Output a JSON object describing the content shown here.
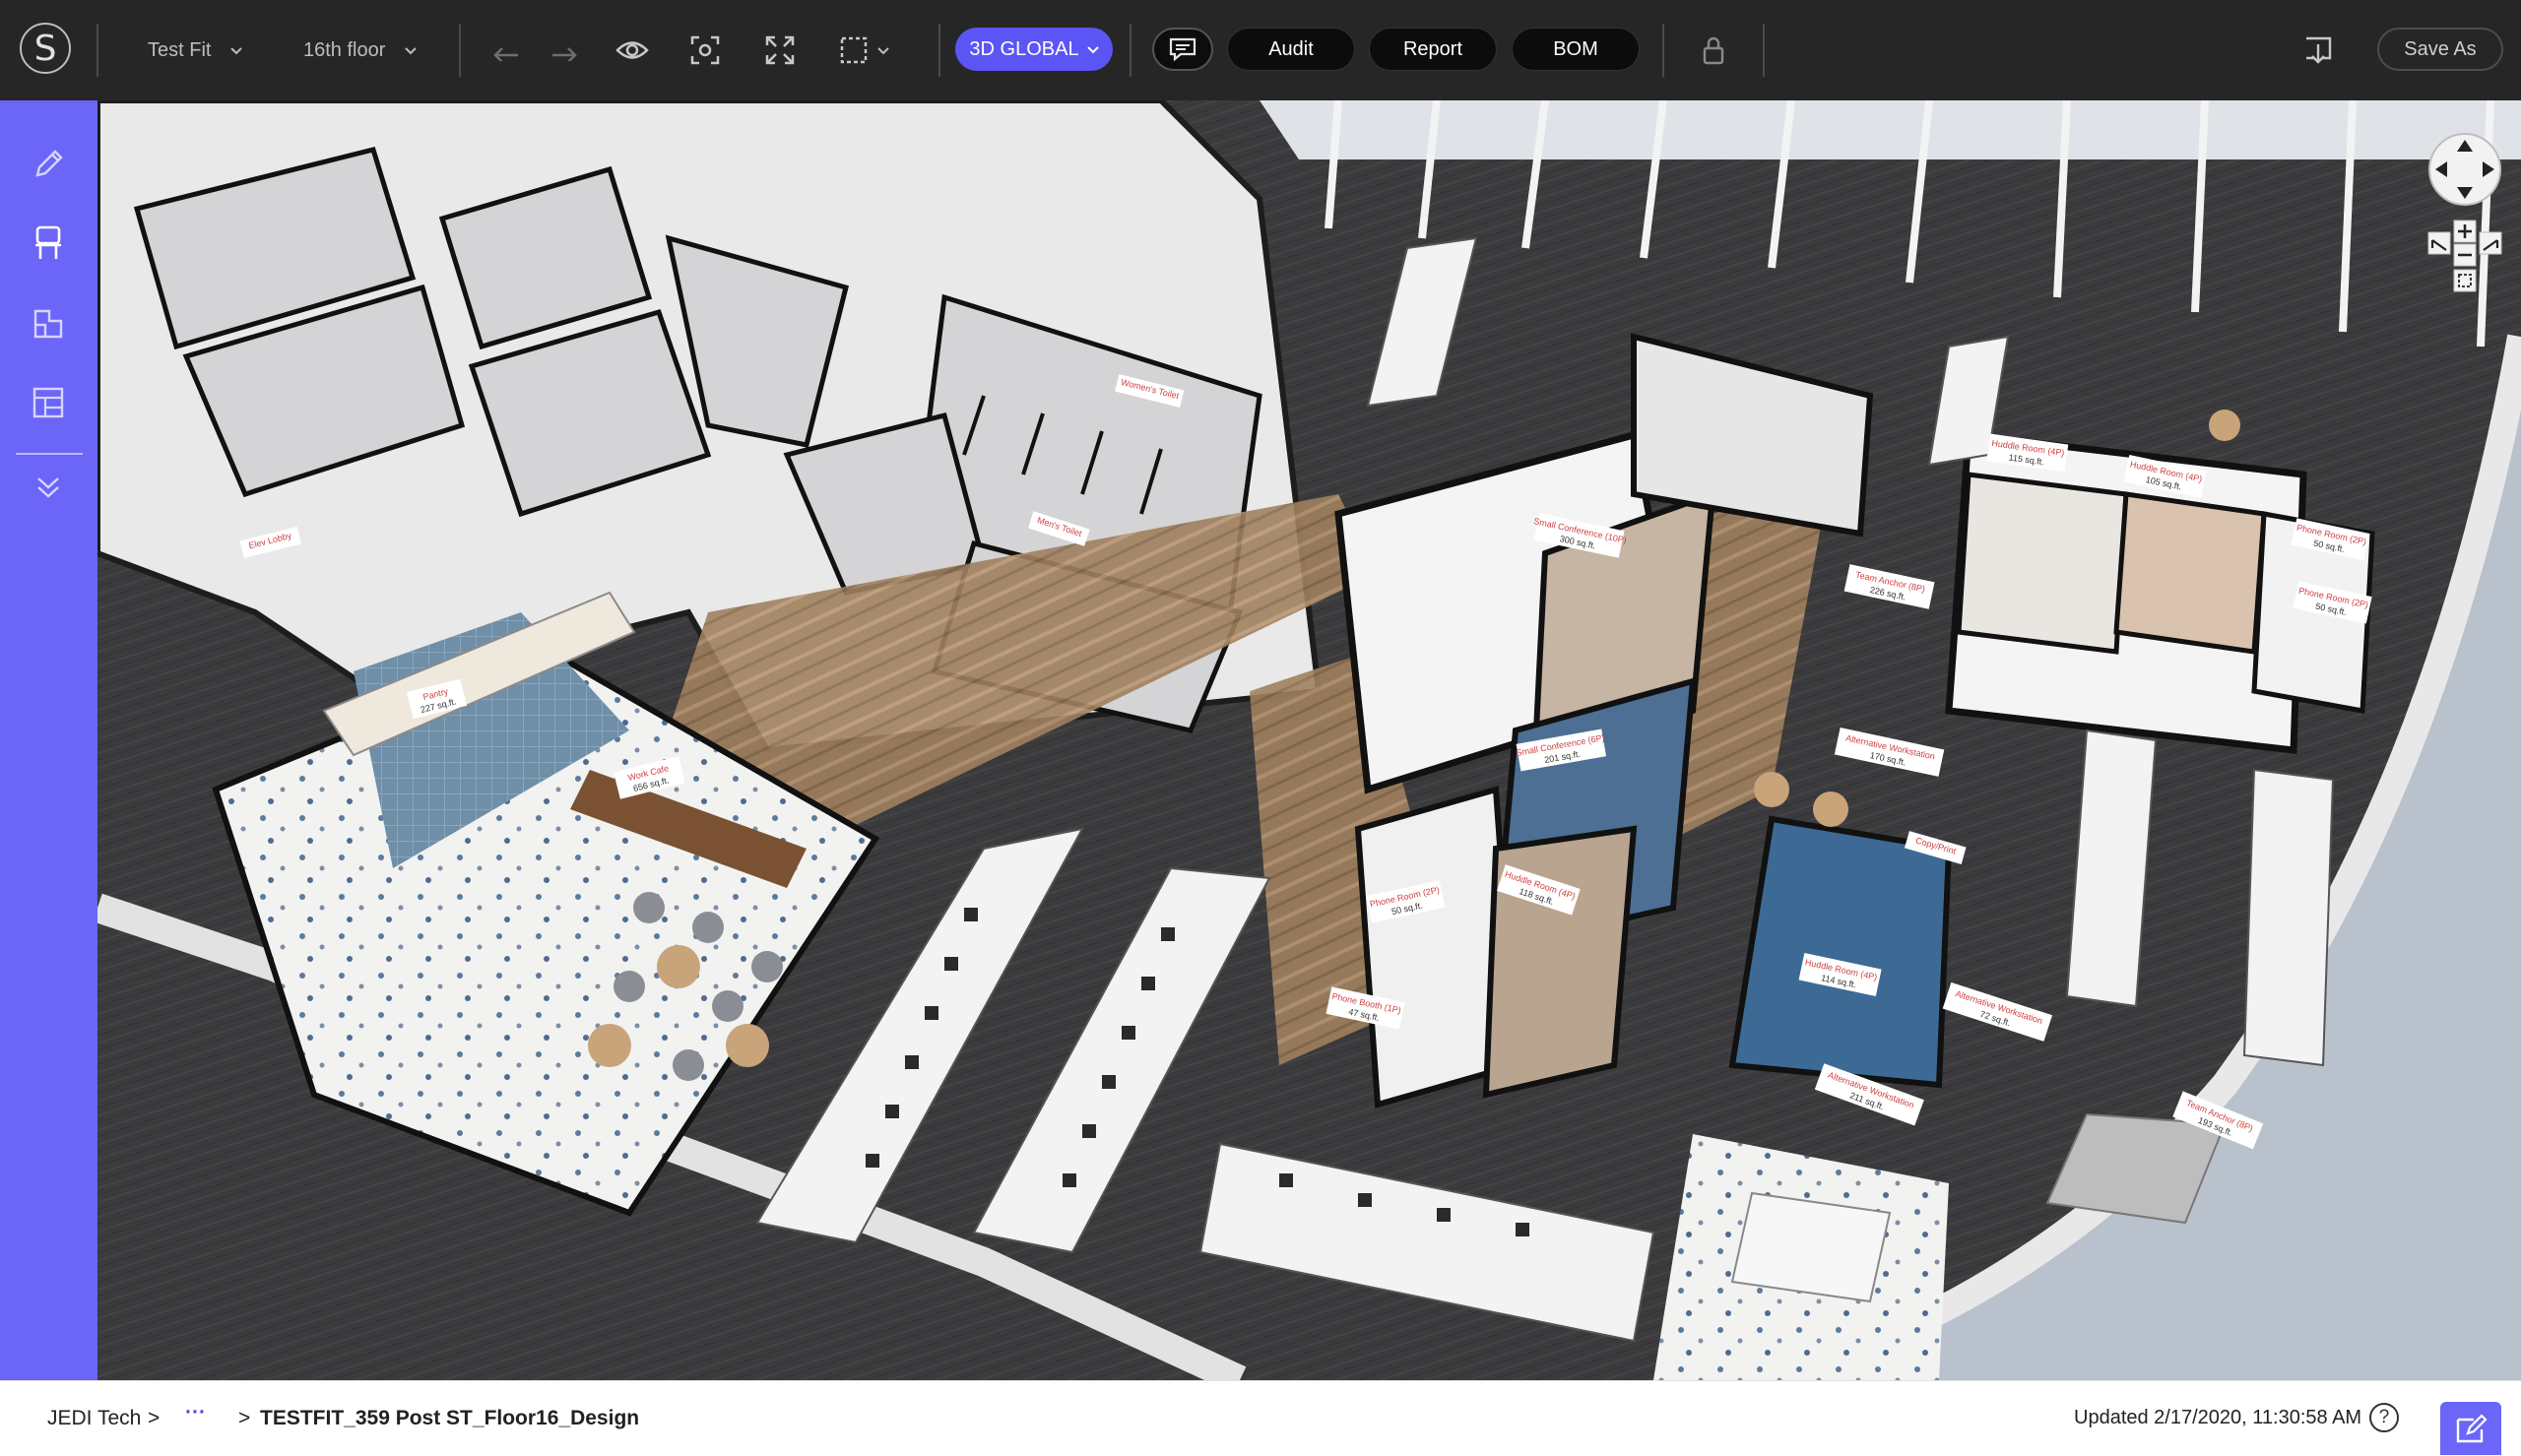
{
  "toolbar": {
    "app_icon": "s-logo-icon",
    "view_selector": "Test Fit",
    "floor_selector": "16th floor",
    "global_button": "3D GLOBAL",
    "audit_button": "Audit",
    "report_button": "Report",
    "bom_button": "BOM",
    "save_as_button": "Save As",
    "icons": [
      "undo-icon",
      "redo-icon",
      "eye-icon",
      "screenshot-icon",
      "fullscreen-icon",
      "select-area-icon",
      "comment-icon",
      "lock-icon",
      "download-icon"
    ]
  },
  "sidebar": {
    "items": [
      "pencil-icon",
      "chair-icon",
      "shapes-icon",
      "floor-plan-icon",
      "chevrons-down-icon"
    ]
  },
  "status": {
    "breadcrumb_root": "JEDI Tech",
    "separator": ">",
    "ellipsis": "···",
    "design_name": "TESTFIT_359 Post ST_Floor16_Design",
    "updated": "Updated 2/17/2020, 11:30:58 AM",
    "help": "?"
  },
  "floorplan": {
    "room_labels": [
      {
        "name": "Small Conference (10P)",
        "area": "300 sq.ft."
      },
      {
        "name": "Small Conference (6P)",
        "area": "201 sq.ft."
      },
      {
        "name": "Huddle Room (4P)",
        "area": "118 sq.ft."
      },
      {
        "name": "Phone Room (2P)",
        "area": "50 sq.ft."
      },
      {
        "name": "Phone Booth (1P)",
        "area": "47 sq.ft."
      },
      {
        "name": "Huddle Room (4P)",
        "area": "114 sq.ft."
      },
      {
        "name": "Alternative Workstation",
        "area": "72 sq.ft."
      },
      {
        "name": "Alternative Workstation",
        "area": "211 sq.ft."
      },
      {
        "name": "Team Anchor (8P)",
        "area": "193 sq.ft."
      },
      {
        "name": "Alternative Workstation",
        "area": "170 sq.ft."
      },
      {
        "name": "Huddle Room (4P)",
        "area": "115 sq.ft."
      },
      {
        "name": "Huddle Room (4P)",
        "area": "105 sq.ft."
      },
      {
        "name": "Phone Room (2P)",
        "area": "50 sq.ft."
      },
      {
        "name": "Phone Room (2P)",
        "area": "50 sq.ft."
      },
      {
        "name": "Team Anchor (8P)",
        "area": "226 sq.ft."
      },
      {
        "name": "Copy/Print",
        "area": ""
      },
      {
        "name": "Work Cafe",
        "area": "656 sq.ft."
      },
      {
        "name": "Pantry",
        "area": "227 sq.ft."
      },
      {
        "name": "Elev Lobby",
        "area": ""
      },
      {
        "name": "Men's Toilet",
        "area": ""
      },
      {
        "name": "Women's Toilet",
        "area": ""
      }
    ]
  },
  "colors": {
    "accent": "#6b65f8",
    "toolbar": "#262626",
    "label_text": "#d04040"
  }
}
